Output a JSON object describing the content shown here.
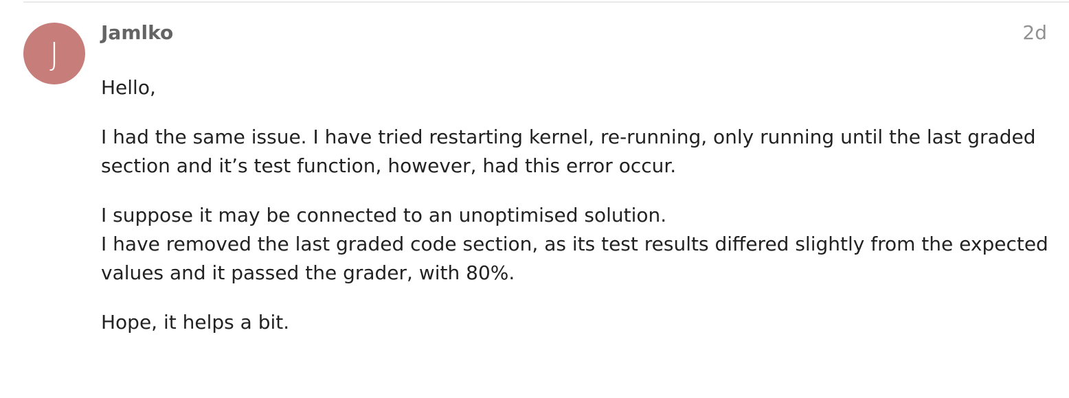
{
  "post": {
    "avatar_letter": "J",
    "username": "Jamlko",
    "date": "2d",
    "paragraphs": [
      {
        "lines": [
          "Hello,"
        ]
      },
      {
        "lines": [
          "I had the same issue. I have tried restarting kernel, re-running, only running until the last graded",
          "section and it’s test function, however, had this error occur."
        ]
      },
      {
        "lines": [
          "I suppose it may be connected to an unoptimised solution.",
          "I have removed the last graded code section, as its test results differed slightly from the expected",
          "values and it passed the grader, with 80%."
        ]
      },
      {
        "lines": [
          "Hope, it helps a bit."
        ]
      }
    ]
  },
  "colors": {
    "avatar_bg": "#c77e7a",
    "username": "#646464",
    "date": "#919191",
    "body_text": "#222222",
    "divider": "#e9e9e9"
  },
  "icons": {
    "avatar": "user-avatar-letter"
  }
}
